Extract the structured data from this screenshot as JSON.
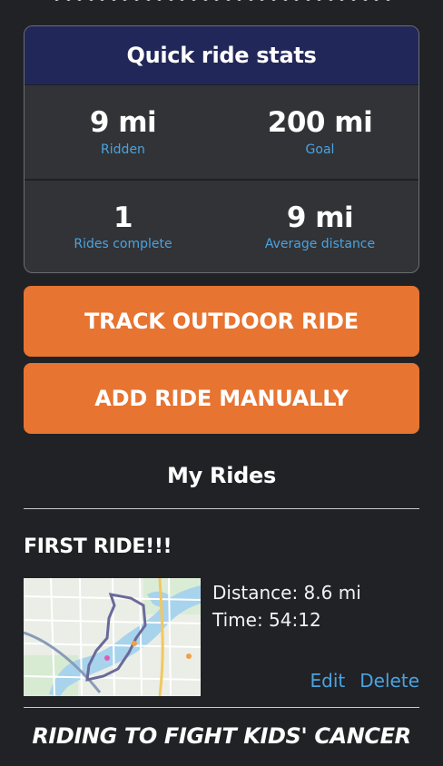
{
  "stats": {
    "title": "Quick ride stats",
    "ridden_value": "9 mi",
    "ridden_label": "Ridden",
    "goal_value": "200 mi",
    "goal_label": "Goal",
    "rides_value": "1",
    "rides_label": "Rides complete",
    "avg_value": "9 mi",
    "avg_label": "Average distance"
  },
  "buttons": {
    "track": "TRACK OUTDOOR RIDE",
    "add": "ADD RIDE MANUALLY"
  },
  "rides_section": {
    "title": "My Rides",
    "rides": [
      {
        "title": "FIRST RIDE!!!",
        "distance": "Distance: 8.6 mi",
        "time": "Time: 54:12",
        "edit": "Edit",
        "delete": "Delete",
        "map": "route-map-thumbnail"
      }
    ]
  },
  "footer": {
    "tagline": "RIDING TO FIGHT KIDS' CANCER"
  },
  "colors": {
    "background": "#212226",
    "card": "#323336",
    "header": "#22275a",
    "accent": "#e77431",
    "link": "#4aa3e0"
  }
}
